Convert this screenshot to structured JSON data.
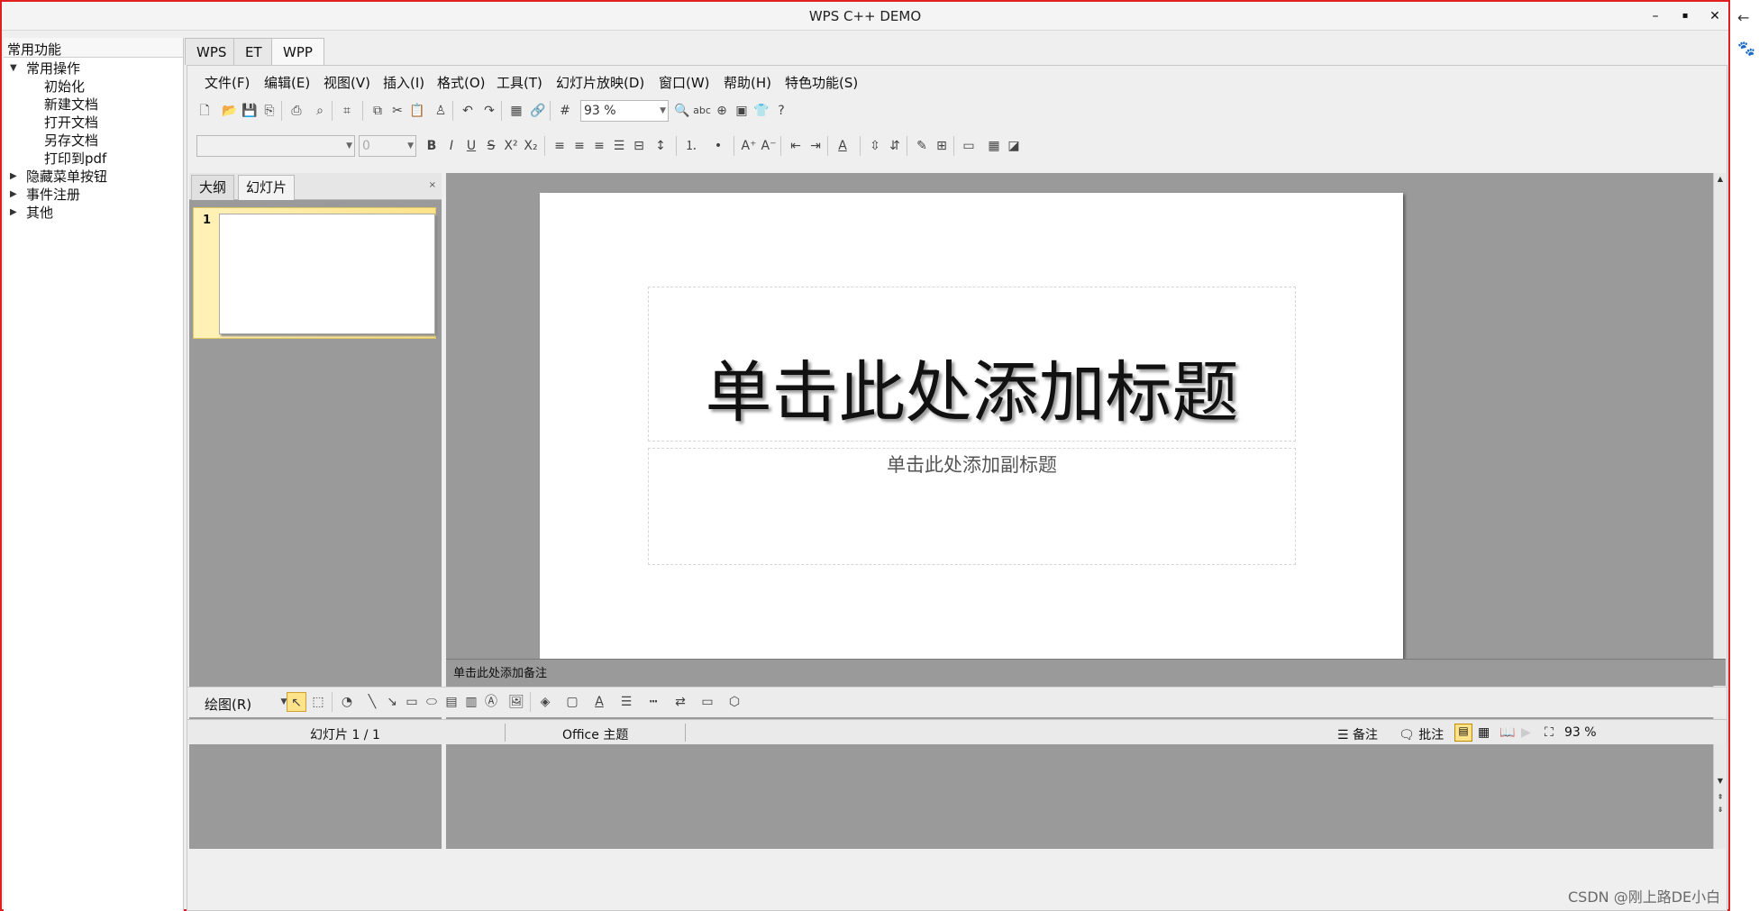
{
  "window": {
    "title": "WPS C++ DEMO",
    "minimize": "–",
    "maximize": "▪",
    "close": "✕"
  },
  "tree": {
    "header": "常用功能",
    "groups": [
      {
        "label": "常用操作",
        "expanded": true,
        "children": [
          "初始化",
          "新建文档",
          "打开文档",
          "另存文档",
          "打印到pdf"
        ]
      },
      {
        "label": "隐藏菜单按钮",
        "expanded": false
      },
      {
        "label": "事件注册",
        "expanded": false
      },
      {
        "label": "其他",
        "expanded": false
      }
    ]
  },
  "top_tabs": [
    "WPS",
    "ET",
    "WPP"
  ],
  "menu": [
    "文件(F)",
    "编辑(E)",
    "视图(V)",
    "插入(I)",
    "格式(O)",
    "工具(T)",
    "幻灯片放映(D)",
    "窗口(W)",
    "帮助(H)",
    "特色功能(S)"
  ],
  "toolbar": {
    "zoom_value": "93 %",
    "font_size_value": "0",
    "help_glyph": "?",
    "spell_glyph": "abc"
  },
  "panel": {
    "tabs": [
      "大纲",
      "幻灯片"
    ],
    "close": "×",
    "slide_number": "1"
  },
  "slide": {
    "title_placeholder": "单击此处添加标题",
    "subtitle_placeholder": "单击此处添加副标题"
  },
  "notes_placeholder": "单击此处添加备注",
  "drawbar": {
    "label": "绘图(R)"
  },
  "status": {
    "slide_info": "幻灯片 1 / 1",
    "theme": "Office 主题",
    "notes": "备注",
    "comments": "批注",
    "zoom": "93 %"
  },
  "watermark": "CSDN @刚上路DE小白",
  "colors": {
    "accent_border": "#e02020",
    "slide_selection": "#ffe38a",
    "canvas": "#9a9a9a"
  }
}
